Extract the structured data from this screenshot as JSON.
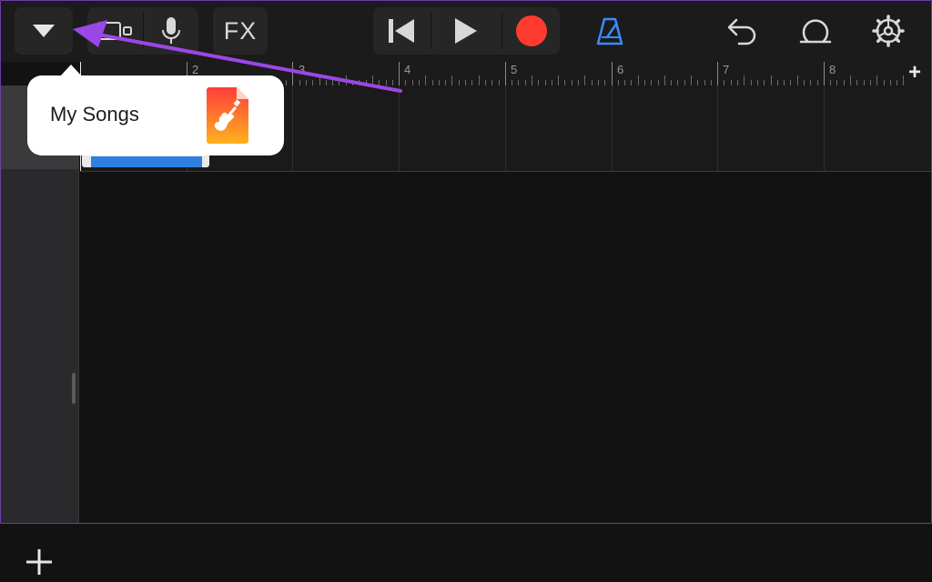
{
  "toolbar": {
    "dropdown_icon": "triangle-down-icon",
    "view_icon": "tracks-view-icon",
    "mic_icon": "microphone-icon",
    "fx_label": "FX",
    "rewind_icon": "skip-back-icon",
    "play_icon": "play-icon",
    "record_icon": "record-icon",
    "metronome_icon": "metronome-icon",
    "undo_icon": "undo-icon",
    "loop_icon": "loop-browser-icon",
    "settings_icon": "settings-gear-icon"
  },
  "ruler": {
    "bars": [
      "2",
      "3",
      "4",
      "5",
      "6",
      "7",
      "8"
    ],
    "add_section_label": "+"
  },
  "popover": {
    "label": "My Songs",
    "icon": "garageband-app-icon"
  },
  "sidebar": {
    "add_track_icon": "plus-icon"
  },
  "colors": {
    "background": "#121212",
    "toolbar": "#1b1b1b",
    "record": "#ff3b30",
    "metronome": "#3a8cff",
    "region": "#2f7fe0",
    "annotation_arrow": "#9b47e6"
  }
}
